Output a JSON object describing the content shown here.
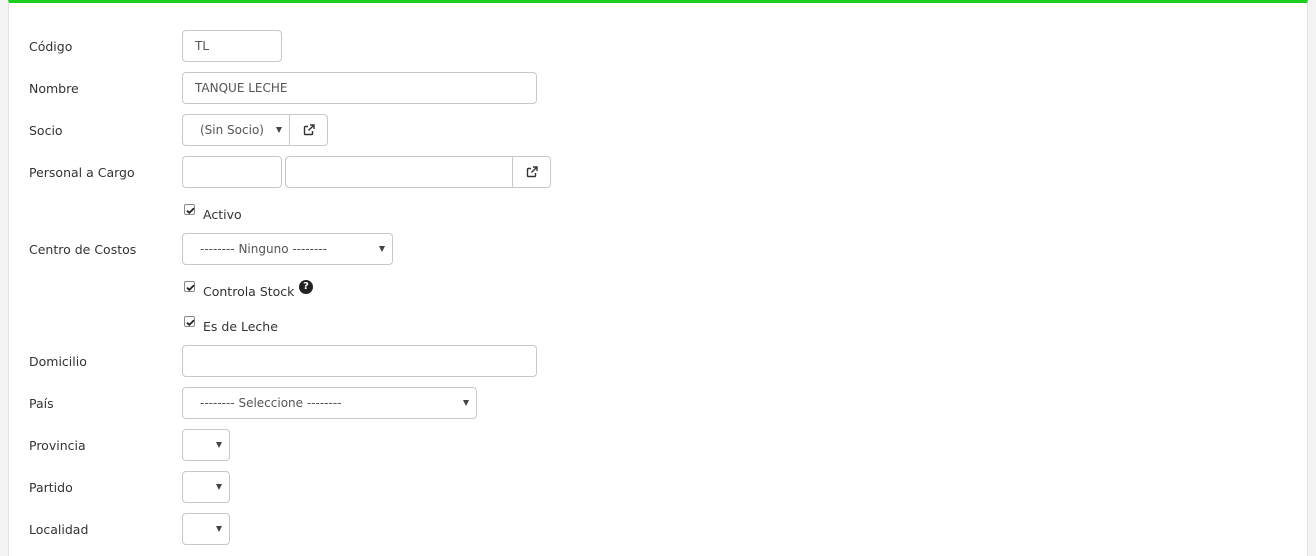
{
  "form": {
    "codigo": {
      "label": "Código",
      "value": "TL"
    },
    "nombre": {
      "label": "Nombre",
      "value": "TANQUE LECHE"
    },
    "socio": {
      "label": "Socio",
      "selected": "(Sin Socio)"
    },
    "personal": {
      "label": "Personal a Cargo",
      "code_value": "",
      "name_value": ""
    },
    "activo": {
      "label": "Activo",
      "checked": true
    },
    "centro_costos": {
      "label": "Centro de Costos",
      "selected": "-------- Ninguno --------"
    },
    "controla_stock": {
      "label": "Controla Stock",
      "checked": true,
      "help_glyph": "?"
    },
    "es_de_leche": {
      "label": "Es de Leche",
      "checked": true
    },
    "domicilio": {
      "label": "Domicilio",
      "value": ""
    },
    "pais": {
      "label": "País",
      "selected": "-------- Seleccione --------"
    },
    "provincia": {
      "label": "Provincia",
      "selected": ""
    },
    "partido": {
      "label": "Partido",
      "selected": ""
    },
    "localidad": {
      "label": "Localidad",
      "selected": ""
    }
  },
  "icons": {
    "external_link": "external-link-icon",
    "checkmark": "checkmark-icon",
    "help": "question-circle-icon",
    "caret": "caret-down-icon"
  },
  "colors": {
    "accent": "#1fcf1f",
    "border": "#c8c8c8",
    "text": "#333333"
  }
}
